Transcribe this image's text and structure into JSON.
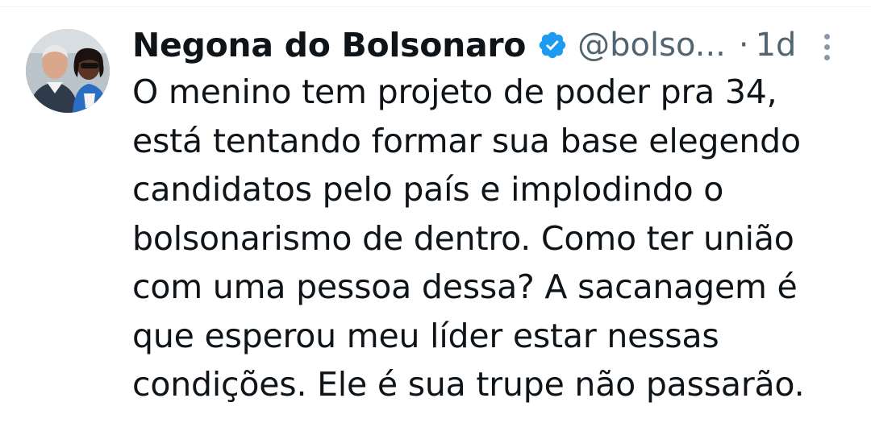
{
  "tweet": {
    "author": {
      "display_name": "Negona do Bolsonaro",
      "handle": "@bolso...",
      "verified": true,
      "verified_color": "#1d9bf0",
      "avatar_icon": "profile-photo"
    },
    "separator": "·",
    "timestamp": "1d",
    "more_icon": "more-vertical-icon",
    "text_lines": [
      "O menino tem projeto de poder pra 34,",
      "está tentando formar sua base elegendo",
      "candidatos pelo país e implodindo o",
      "bolsonarismo de dentro. Como ter união",
      "com uma pessoa dessa? A sacanagem é",
      "que esperou meu líder estar nessas",
      "condições. Ele é sua trupe não passarão."
    ]
  }
}
